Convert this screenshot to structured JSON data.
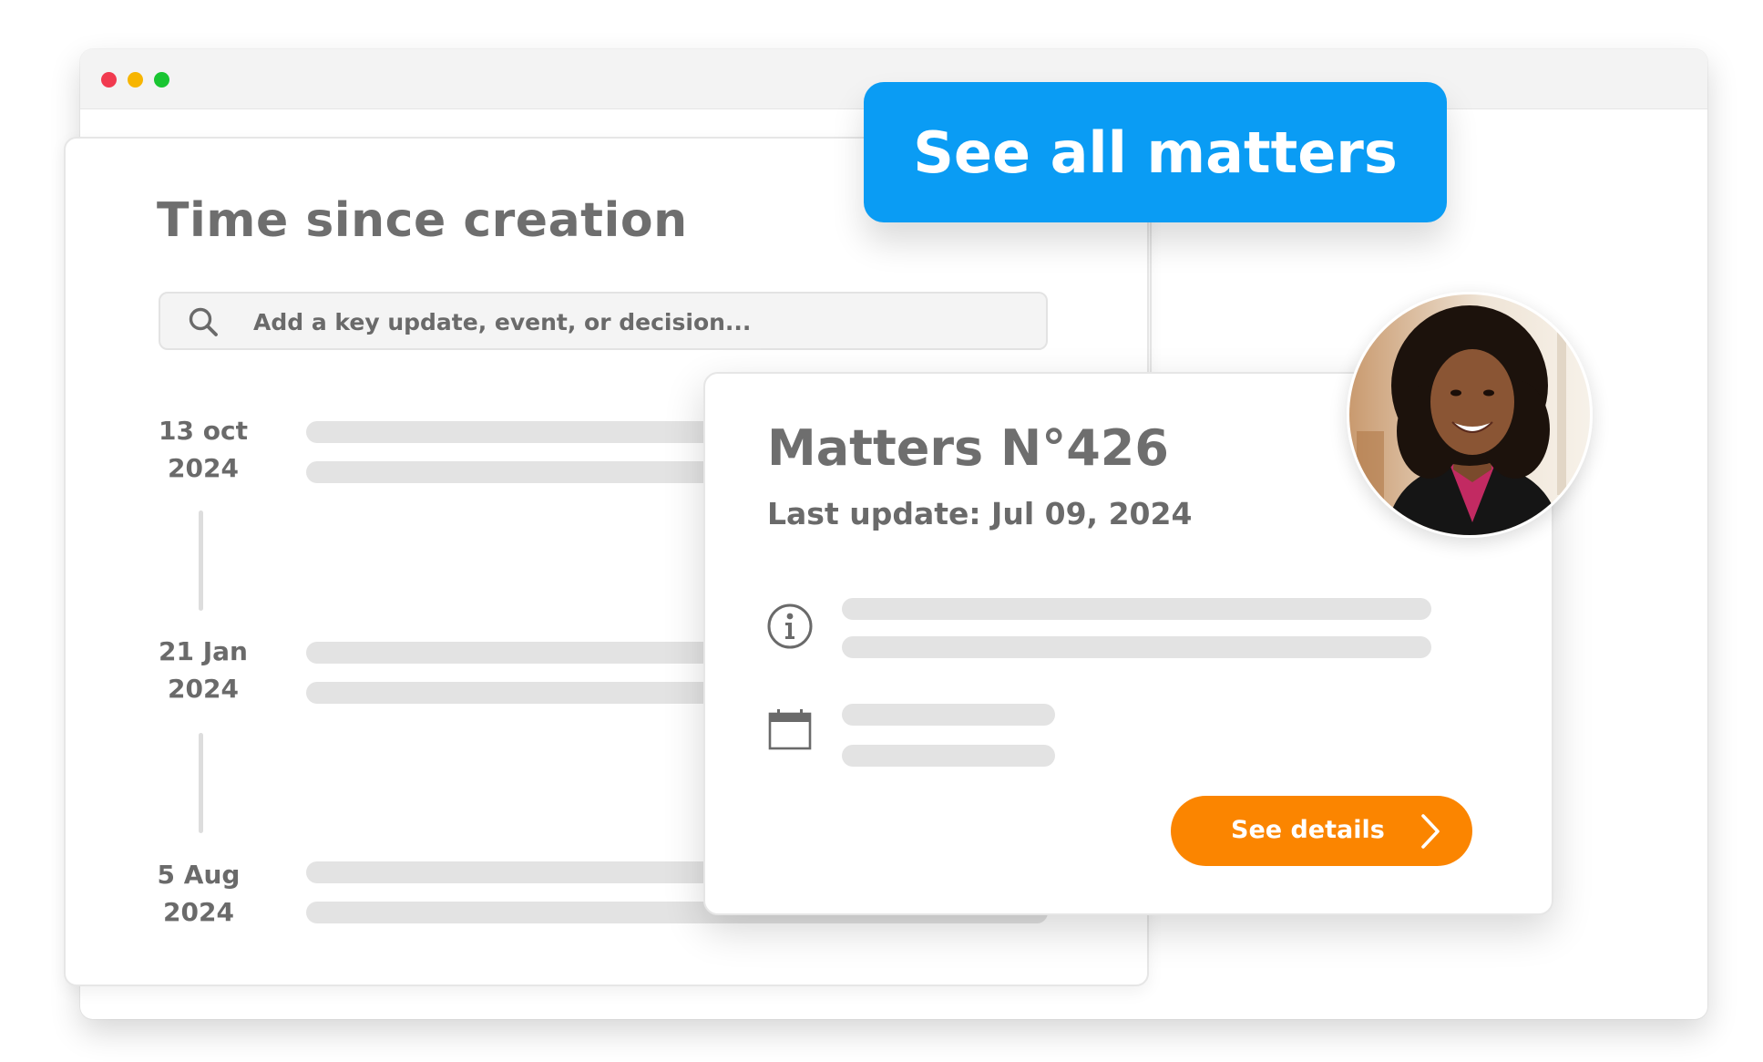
{
  "window": {
    "controls": [
      "close",
      "minimize",
      "maximize"
    ]
  },
  "cta": {
    "see_all_label": "See all matters"
  },
  "timeline": {
    "title": "Time since creation",
    "search_placeholder": "Add a key update, event, or decision...",
    "entries": [
      {
        "day": "13 oct",
        "year": "2024"
      },
      {
        "day": "21 Jan",
        "year": "2024"
      },
      {
        "day": "5 Aug",
        "year": "2024"
      }
    ]
  },
  "matter": {
    "title": "Matters N°426",
    "last_update": "Last update: Jul 09, 2024",
    "details_label": "See details"
  },
  "icons": [
    "search-icon",
    "info-icon",
    "calendar-icon",
    "chevron-right-icon"
  ],
  "colors": {
    "primary_blue": "#0a9cf4",
    "accent_orange": "#fb8500",
    "text_gray": "#6e6e6e",
    "skeleton_gray": "#e3e3e3"
  }
}
